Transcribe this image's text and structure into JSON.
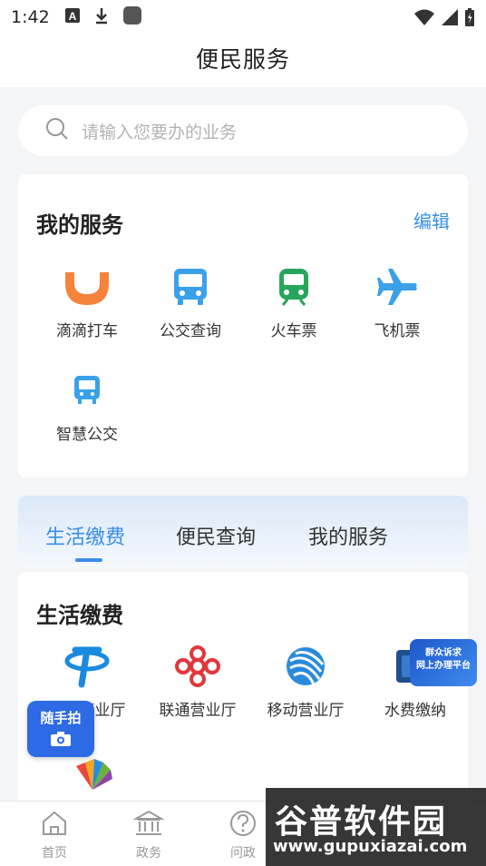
{
  "status_bar": {
    "time": "1:42"
  },
  "header": {
    "title": "便民服务"
  },
  "search": {
    "placeholder": "请输入您要办的业务"
  },
  "my_services": {
    "title": "我的服务",
    "edit_label": "编辑",
    "items": [
      {
        "label": "滴滴打车",
        "icon": "didi-icon",
        "color": "#f5833b"
      },
      {
        "label": "公交查询",
        "icon": "bus-icon",
        "color": "#3aa1e8"
      },
      {
        "label": "火车票",
        "icon": "train-icon",
        "color": "#28a55c"
      },
      {
        "label": "飞机票",
        "icon": "plane-icon",
        "color": "#3aa1e8"
      },
      {
        "label": "智慧公交",
        "icon": "smart-bus-icon",
        "color": "#3aa1e8"
      }
    ]
  },
  "tabs": [
    {
      "label": "生活缴费",
      "active": true
    },
    {
      "label": "便民查询",
      "active": false
    },
    {
      "label": "我的服务",
      "active": false
    }
  ],
  "life_payment": {
    "title": "生活缴费",
    "items": [
      {
        "label": "电信营业厅",
        "icon": "china-telecom-icon"
      },
      {
        "label": "联通营业厅",
        "icon": "china-unicom-icon"
      },
      {
        "label": "移动营业厅",
        "icon": "china-mobile-icon"
      },
      {
        "label": "水费缴纳",
        "icon": "water-fee-icon"
      }
    ]
  },
  "float_camera": {
    "label": "随手拍"
  },
  "float_banner": {
    "line1": "群众诉求",
    "line2": "网上办理平台"
  },
  "bottom_nav": [
    {
      "label": "首页",
      "icon": "home-icon"
    },
    {
      "label": "政务",
      "icon": "government-icon"
    },
    {
      "label": "问政",
      "icon": "question-icon"
    }
  ],
  "watermark": {
    "line1": "谷普软件园",
    "line2": "www.gupuxiazai.com"
  },
  "colors": {
    "accent": "#3a8ee6",
    "background": "#f4f5f7"
  }
}
